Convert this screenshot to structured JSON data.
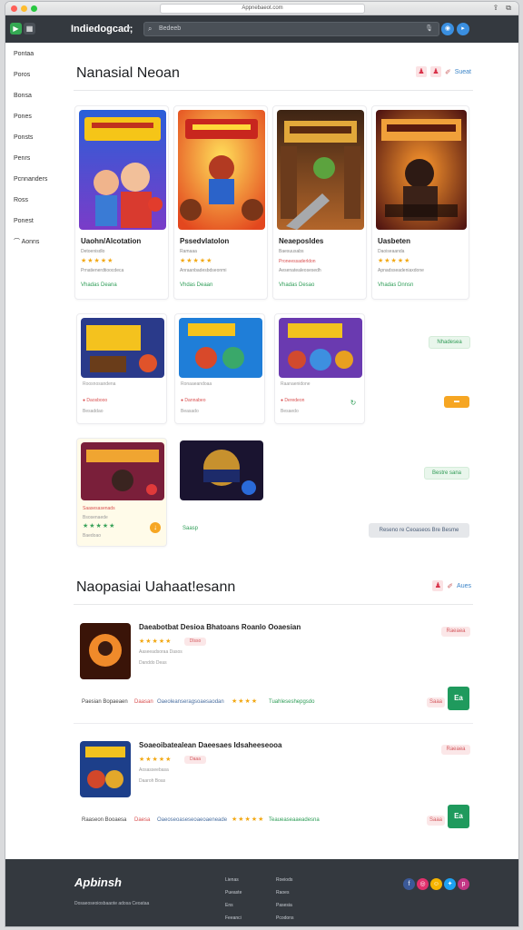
{
  "browser": {
    "url": "Appnebaeot.com",
    "traffic_colors": [
      "#ff5f57",
      "#febc2e",
      "#28c840"
    ]
  },
  "appbar": {
    "title": "Indiedogcad;",
    "chevron": "▾",
    "search_placeholder": "Bedeeb",
    "search_icon": "search-icon",
    "mic_icon": "microphone-icon",
    "logo_left_icon": "play-store-icon",
    "logo_right_icon": "grid-icon"
  },
  "sidebar": {
    "items": [
      {
        "label": "Pontaa"
      },
      {
        "label": "Poros"
      },
      {
        "label": "Bonsa"
      },
      {
        "label": "Pones"
      },
      {
        "label": "Ponsts"
      },
      {
        "label": "Penrs"
      },
      {
        "label": "Pcnnanders"
      },
      {
        "label": "Ross"
      },
      {
        "label": "Ponest"
      },
      {
        "label": "Aonns"
      }
    ]
  },
  "section1": {
    "title": "Nanasial Neoan",
    "tools_text": "Sueat",
    "featured": [
      {
        "name": "Uaohn/Alcotation",
        "dev": "Detoenisdlo",
        "stars": "★★★★★",
        "sub": "Prnatienerdtioocdeca",
        "price": "Vhadas Deana"
      },
      {
        "name": "Pssedvlatolon",
        "dev": "Ramaaa",
        "stars": "★★★★★",
        "sub": "Anraanbadesbdseonmi",
        "price": "Vhdas Deaan"
      },
      {
        "name": "Neaeposldes",
        "dev": "Baesuusabs",
        "stars": "",
        "sub": "Proneessaderldon",
        "sub2": "Aesenatealeosesedh",
        "price": "Vhadas Desao"
      },
      {
        "name": "Uasbeten",
        "dev": "Daoiseaanda",
        "stars": "★★★★★",
        "sub": "Apnadsseadeniaxdone",
        "price": "Vhadas Dnnsn"
      }
    ],
    "row2": [
      {
        "sub": "Roosnosandena",
        "sub2": "Daosbooo",
        "sub3": "Besaddao"
      },
      {
        "sub": "Ronaaeandoaa",
        "sub2": "Dannabeo",
        "sub3": "Beasado"
      },
      {
        "sub": "Raanaenidone",
        "sub2": "Deredeon",
        "sub3": "Besaedo"
      }
    ],
    "row2_btn": "Nhadesea",
    "row3": [
      {
        "sub": "Saasesasenads",
        "sub2": "Bsosenaede",
        "stars": "★★★★★",
        "sub3": "Baedoao"
      },
      {
        "price": "Saasp"
      }
    ],
    "row3_btn": "Bestre sana",
    "more_btn": "Reseno re Ceoaseos Bre Besme"
  },
  "section2": {
    "title": "Naopasiai Uahaat!esann",
    "tools_text": "Aues",
    "items": [
      {
        "title": "Daeabotbat Desioa Bhatoans Roanlo Ooaesian",
        "stars": "★★★★★",
        "tag": "Dlsso",
        "line1": "Aaseeadsoraa Dasos",
        "line2": "Danddo Deas",
        "bottom1": "Paesian Bopaeaen",
        "bottom2": "Daasan",
        "bottom3": "Oaeoleanseragsoaesaodan",
        "bottom_stars": "★★★★",
        "bottom4": "Tuahleseshepgsdo",
        "tag_right": "Raeaea",
        "pill": "Saaa",
        "big_btn": "Ea"
      },
      {
        "title": "Soaeoibatealean Daeesaes Idsaheeseooa",
        "stars": "★★★★★",
        "tag": "Daaa",
        "line1": "Aosasseebasa",
        "line2": "Daaroh Boas",
        "bottom1": "Raaseon Booaesa",
        "bottom2": "Daesa",
        "bottom3": "Oaeoseoaseseoaeoaeneade",
        "bottom_stars": "★★★★★",
        "bottom4": "Teaueaseaaeadesna",
        "tag_right": "Raeaea",
        "pill": "Saaa",
        "big_btn": "Ea"
      }
    ]
  },
  "footer": {
    "logo": "Apbinsh",
    "sub": "Dosaeoseoiosbaaote adosa Ceoataa",
    "col1": [
      "Lienas",
      "Pueaste",
      "Ens",
      "Feeanci"
    ],
    "col2": [
      "Roeiods",
      "Raoes",
      "Pasesia",
      "Pcodons"
    ],
    "social_colors": [
      "#3b5998",
      "#e1306c",
      "#f5b400",
      "#1da1f2",
      "#c13584"
    ],
    "social_icons": [
      "facebook-icon",
      "instagram-icon",
      "snapchat-icon",
      "twitter-icon",
      "pinterest-icon"
    ]
  }
}
